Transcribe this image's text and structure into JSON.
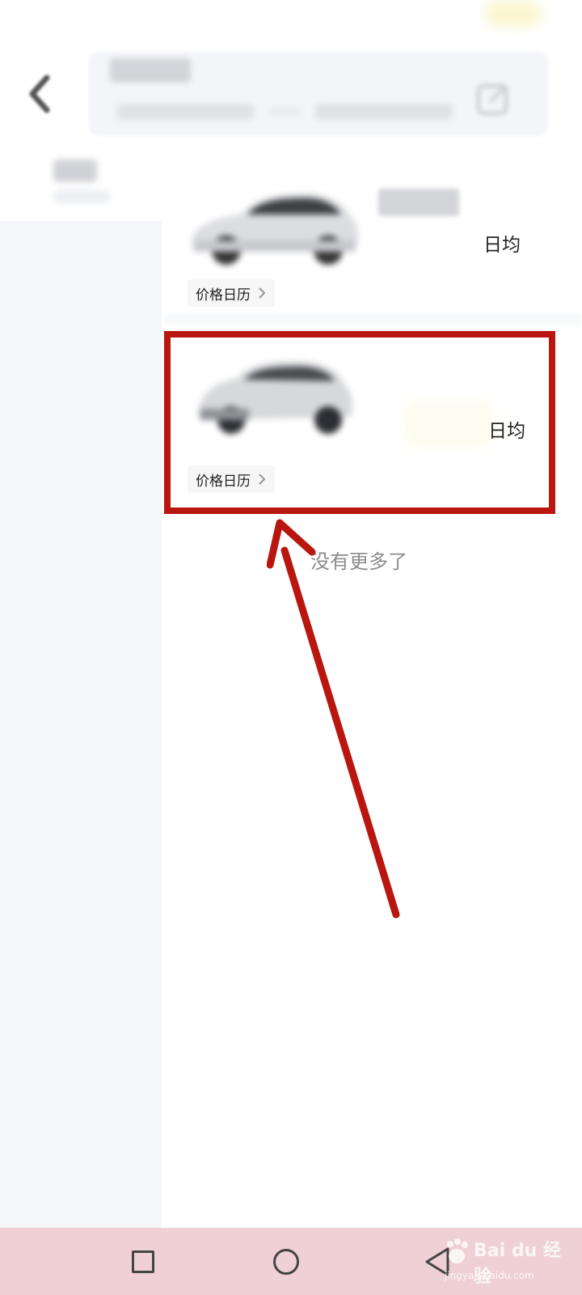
{
  "cards": [
    {
      "price_suffix": "日均",
      "calendar_label": "价格日历"
    },
    {
      "price_suffix": "日均",
      "calendar_label": "价格日历"
    }
  ],
  "list_end_text": "没有更多了",
  "watermark": {
    "brand": "Bai du 经验",
    "url": "jingyan.baidu.com"
  },
  "icons": [
    "back-icon",
    "edit-icon",
    "chevron-right-icon",
    "nav-recent-icon",
    "nav-home-icon",
    "nav-back-icon",
    "baidu-paw-icon"
  ],
  "colors": {
    "highlight": "#b8160e",
    "navbar": "#efd0d5",
    "sidebar": "#f5f6f9"
  }
}
